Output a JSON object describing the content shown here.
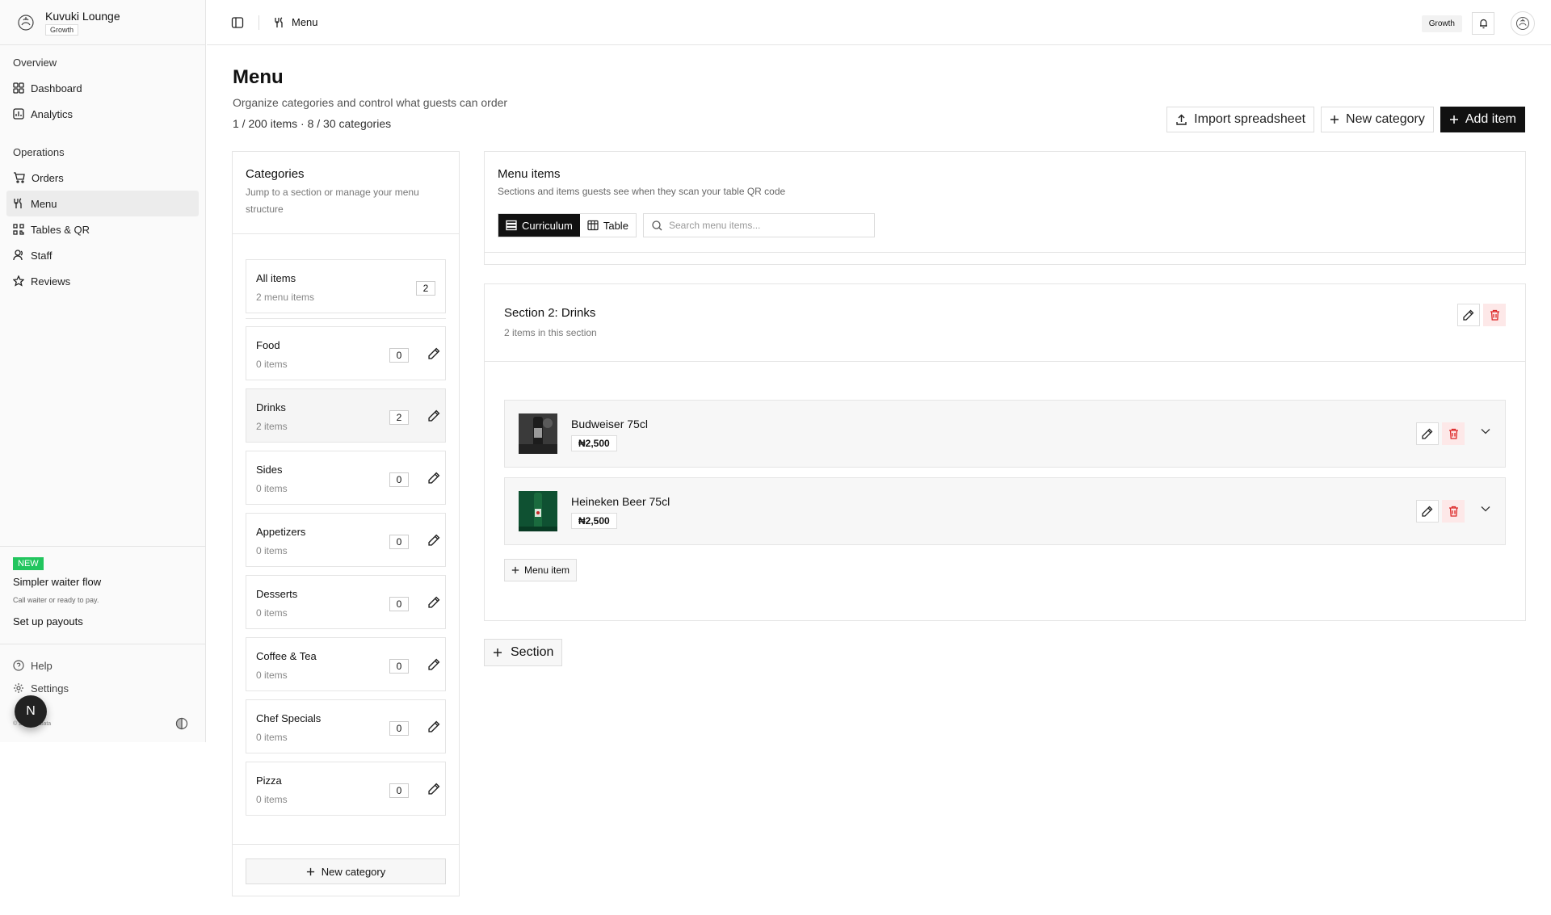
{
  "sidebar": {
    "brand": {
      "name": "Kuvuki Lounge",
      "plan": "Growth"
    },
    "groups": [
      {
        "label": "Overview",
        "items": [
          {
            "label": "Dashboard",
            "icon": "grid-icon"
          },
          {
            "label": "Analytics",
            "icon": "chart-icon"
          }
        ]
      },
      {
        "label": "Operations",
        "items": [
          {
            "label": "Orders",
            "icon": "cart-icon"
          },
          {
            "label": "Menu",
            "icon": "utensils-icon",
            "active": true
          },
          {
            "label": "Tables & QR",
            "icon": "qr-icon"
          },
          {
            "label": "Staff",
            "icon": "users-icon"
          },
          {
            "label": "Reviews",
            "icon": "star-icon"
          }
        ]
      }
    ],
    "promo": {
      "badge": "NEW",
      "title": "Simpler waiter flow",
      "subtitle": "Call waiter or ready to pay.",
      "link": "Set up payouts"
    },
    "footer": {
      "help": "Help",
      "settings": "Settings",
      "copyright": "© 2025 Nabata",
      "avatar_letter": "N"
    }
  },
  "topbar": {
    "breadcrumb": "Menu",
    "plan": "Growth"
  },
  "page": {
    "title": "Menu",
    "subtitle": "Organize categories and control what guests can order",
    "stats": "1 / 200 items · 8 / 30 categories",
    "actions": {
      "import": "Import spreadsheet",
      "new_category": "New category",
      "add_item": "Add item"
    }
  },
  "categories": {
    "title": "Categories",
    "subtitle": "Jump to a section or manage your menu structure",
    "all": {
      "name": "All items",
      "count_label": "2 menu items",
      "count": "2"
    },
    "items": [
      {
        "name": "Food",
        "count_label": "0 items",
        "count": "0"
      },
      {
        "name": "Drinks",
        "count_label": "2 items",
        "count": "2",
        "active": true
      },
      {
        "name": "Sides",
        "count_label": "0 items",
        "count": "0"
      },
      {
        "name": "Appetizers",
        "count_label": "0 items",
        "count": "0"
      },
      {
        "name": "Desserts",
        "count_label": "0 items",
        "count": "0"
      },
      {
        "name": "Coffee & Tea",
        "count_label": "0 items",
        "count": "0"
      },
      {
        "name": "Chef Specials",
        "count_label": "0 items",
        "count": "0"
      },
      {
        "name": "Pizza",
        "count_label": "0 items",
        "count": "0"
      }
    ],
    "new_button": "New category"
  },
  "menu_items": {
    "title": "Menu items",
    "subtitle": "Sections and items guests see when they scan your table QR code",
    "views": {
      "curriculum": "Curriculum",
      "table": "Table"
    },
    "search": {
      "placeholder": "Search menu items...",
      "value": ""
    }
  },
  "section": {
    "title": "Section 2: Drinks",
    "subtitle": "2 items in this section",
    "items": [
      {
        "name": "Budweiser 75cl",
        "price": "₦2,500"
      },
      {
        "name": "Heineken Beer 75cl",
        "price": "₦2,500"
      }
    ],
    "add_item": "Menu item",
    "add_section": "Section"
  },
  "colors": {
    "accent": "#111111",
    "danger": "#dc2626",
    "danger_bg": "#fde8e8",
    "new_badge": "#22c55e"
  }
}
